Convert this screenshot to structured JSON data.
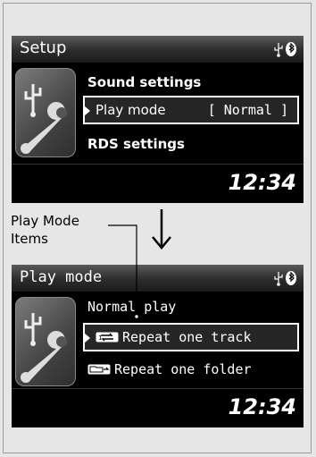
{
  "top_screen": {
    "title": "Setup",
    "menu": [
      {
        "label": "Sound settings"
      },
      {
        "label": "Play mode",
        "value": "[ Normal ]",
        "selected": true
      },
      {
        "label": "RDS settings"
      }
    ],
    "clock": "12:34"
  },
  "callout": {
    "label_line1": "Play Mode",
    "label_line2": "Items"
  },
  "bottom_screen": {
    "title": "Play mode",
    "menu": [
      {
        "label": "Normal play"
      },
      {
        "label": "Repeat one track",
        "icon": "repeat-one-track-icon",
        "selected": true
      },
      {
        "label": "Repeat one folder",
        "icon": "repeat-one-folder-icon"
      }
    ],
    "clock": "12:34"
  },
  "status_icons": [
    "usb-icon",
    "bluetooth-icon"
  ]
}
